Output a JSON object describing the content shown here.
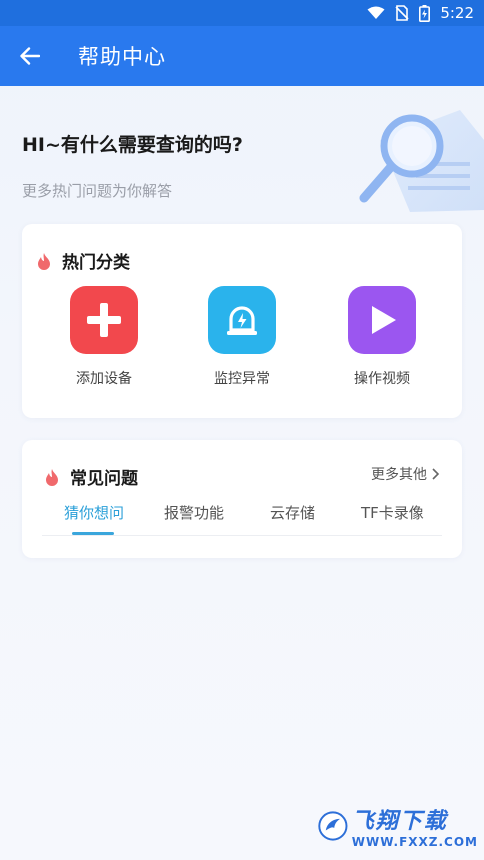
{
  "status_bar": {
    "time": "5:22",
    "icons": [
      "wifi-icon",
      "no-sim-icon",
      "battery-icon"
    ]
  },
  "app_bar": {
    "back_icon": "arrow-left-icon",
    "title": "帮助中心",
    "color": "#2979ee"
  },
  "hero": {
    "title": "HI~有什么需要查询的吗?",
    "subtitle": "更多热门问题为你解答",
    "illustration": "magnifier-document-illustration"
  },
  "hot_categories": {
    "title": "热门分类",
    "icon": "flame-icon",
    "items": [
      {
        "label": "添加设备",
        "icon": "plus-icon",
        "color": "#f2484d"
      },
      {
        "label": "监控异常",
        "icon": "alarm-light-icon",
        "color": "#2ab3ec"
      },
      {
        "label": "操作视频",
        "icon": "play-icon",
        "color": "#9b56f0"
      }
    ]
  },
  "faq": {
    "title": "常见问题",
    "icon": "flame-icon",
    "more_label": "更多其他",
    "tabs": [
      {
        "label": "猜你想问",
        "active": true
      },
      {
        "label": "报警功能",
        "active": false
      },
      {
        "label": "云存储",
        "active": false
      },
      {
        "label": "TF卡录像",
        "active": false
      }
    ],
    "accent": "#2a9fd8"
  },
  "watermark": {
    "text": "飞翔下载",
    "url": "WWW.FXXZ.COM"
  }
}
